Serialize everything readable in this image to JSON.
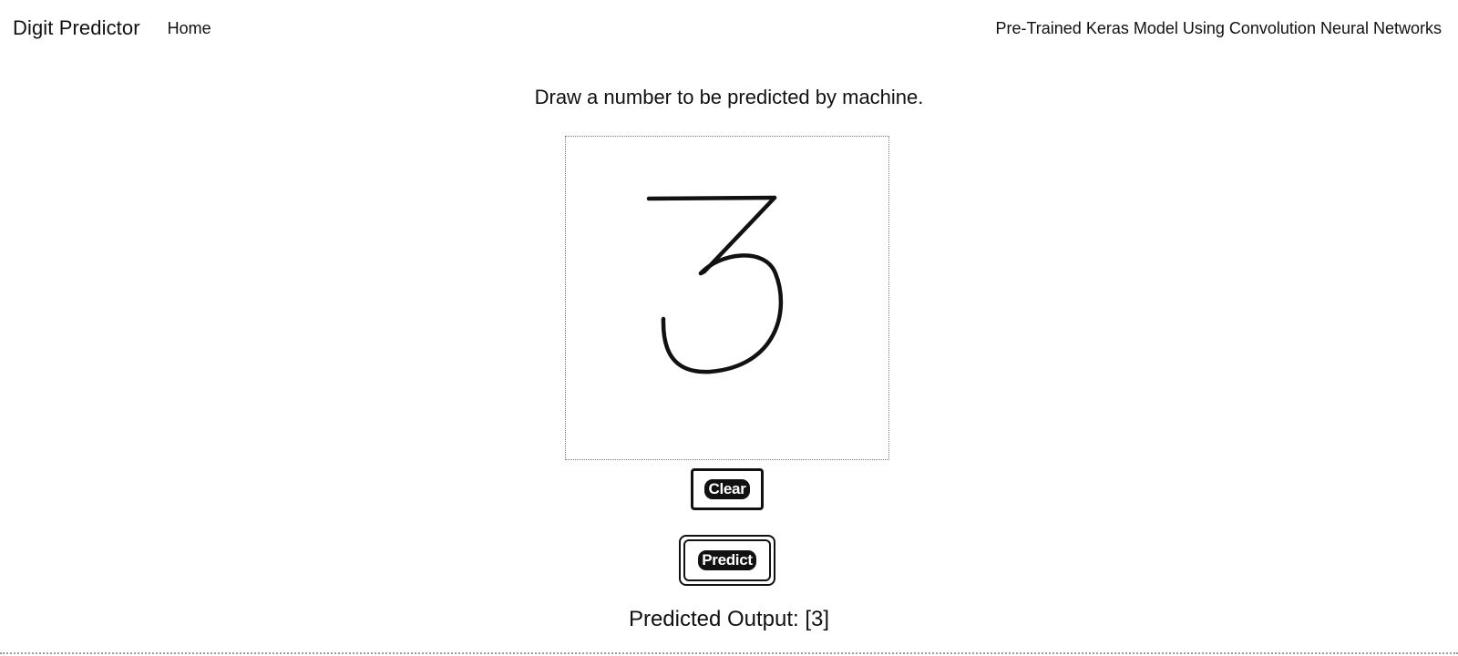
{
  "navbar": {
    "brand": "Digit Predictor",
    "home_link": "Home",
    "tagline": "Pre-Trained Keras Model Using Convolution Neural Networks"
  },
  "main": {
    "instruction": "Draw a number to be predicted by machine.",
    "canvas": {
      "drawn_digit": "3",
      "stroke_color": "#111111"
    },
    "clear_label": "Clear",
    "predict_label": "Predict",
    "output_text": "Predicted Output: [3]"
  }
}
